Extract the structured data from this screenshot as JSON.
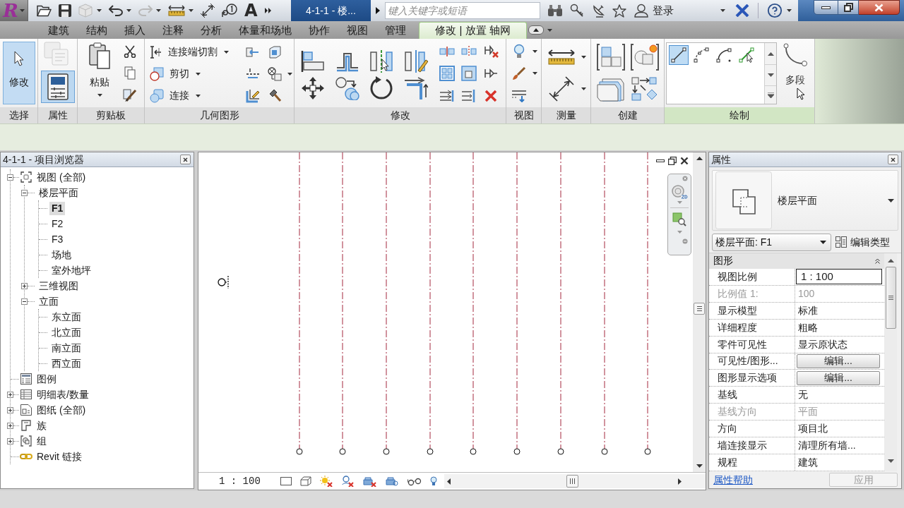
{
  "title_bar": {
    "app_logo": "R",
    "quick_access": [
      {
        "kind": "open",
        "disabled": false
      },
      {
        "kind": "save",
        "disabled": false
      },
      {
        "kind": "sync",
        "disabled": true
      },
      {
        "kind": "undo",
        "disabled": false
      },
      {
        "kind": "redo",
        "disabled": true
      },
      {
        "kind": "measure",
        "disabled": false
      },
      {
        "kind": "dimension",
        "disabled": false
      },
      {
        "kind": "tag",
        "disabled": false
      },
      {
        "kind": "text",
        "label": "A",
        "disabled": false
      }
    ],
    "document_title": "4-1-1 - 楼...",
    "search": {
      "placeholder": "键入关键字或短语"
    },
    "sign_in": "登录"
  },
  "ribbon": {
    "tabs": [
      {
        "label": "建筑",
        "selected": false
      },
      {
        "label": "结构",
        "selected": false
      },
      {
        "label": "插入",
        "selected": false
      },
      {
        "label": "注释",
        "selected": false
      },
      {
        "label": "分析",
        "selected": false
      },
      {
        "label": "体量和场地",
        "selected": false
      },
      {
        "label": "协作",
        "selected": false
      },
      {
        "label": "视图",
        "selected": false
      },
      {
        "label": "管理",
        "selected": false
      },
      {
        "label": "修改 | 放置 轴网",
        "selected": true
      }
    ],
    "panels": [
      {
        "kind": "select",
        "title": "选择",
        "tool": {
          "label": "修改",
          "selected": true
        }
      },
      {
        "kind": "properties",
        "title": "属性",
        "type_properties": {
          "disabled": true
        },
        "properties_toggle": {
          "selected": true
        }
      },
      {
        "kind": "clipboard",
        "title": "剪贴板",
        "paste": {
          "label": "粘贴"
        }
      },
      {
        "kind": "geometry",
        "title": "几何图形",
        "tools": [
          {
            "label": "连接端切割"
          },
          {
            "label": "剪切"
          },
          {
            "label": "连接"
          }
        ]
      },
      {
        "kind": "modify",
        "title": "修改"
      },
      {
        "kind": "view",
        "title": "视图"
      },
      {
        "kind": "measure",
        "title": "测量"
      },
      {
        "kind": "create",
        "title": "创建"
      },
      {
        "kind": "draw",
        "title": "绘制",
        "shapes": [
          {
            "selected": true
          },
          {
            "selected": false
          },
          {
            "selected": false
          },
          {
            "selected": false
          }
        ],
        "multi_segment": {
          "label": "多段"
        }
      }
    ]
  },
  "project_browser": {
    "title": "4-1-1 - 项目浏览器",
    "tree": [
      {
        "label": "视图 (全部)",
        "expanded": true,
        "selected": false,
        "children": [
          {
            "label": "楼层平面",
            "expanded": true,
            "selected": false,
            "children": [
              {
                "label": "F1",
                "selected": true
              },
              {
                "label": "F2",
                "selected": false
              },
              {
                "label": "F3",
                "selected": false
              },
              {
                "label": "场地",
                "selected": false
              },
              {
                "label": "室外地坪",
                "selected": false
              }
            ]
          },
          {
            "label": "三维视图",
            "expanded": false,
            "selected": false
          },
          {
            "label": "立面",
            "expanded": true,
            "selected": false,
            "children": [
              {
                "label": "东立面",
                "selected": false
              },
              {
                "label": "北立面",
                "selected": false
              },
              {
                "label": "南立面",
                "selected": false
              },
              {
                "label": "西立面",
                "selected": false
              }
            ]
          }
        ]
      },
      {
        "label": "图例",
        "selected": false
      },
      {
        "label": "明细表/数量",
        "expanded": false,
        "selected": false
      },
      {
        "label": "图纸 (全部)",
        "expanded": false,
        "selected": false
      },
      {
        "label": "族",
        "expanded": false,
        "selected": false
      },
      {
        "label": "组",
        "expanded": false,
        "selected": false
      },
      {
        "label": "Revit 链接",
        "selected": false
      }
    ]
  },
  "view": {
    "scale": "1 : 100"
  },
  "properties": {
    "title": "属性",
    "type_name": "楼层平面",
    "instance_selector": "楼层平面: F1",
    "edit_type": "编辑类型",
    "group": {
      "label": "图形",
      "expanded": true
    },
    "rows": [
      {
        "name": "视图比例",
        "value": "1 : 100",
        "kind": "input",
        "disabled": false
      },
      {
        "name": "比例值 1:",
        "value": "100",
        "kind": "text",
        "disabled": true
      },
      {
        "name": "显示模型",
        "value": "标准",
        "kind": "text",
        "disabled": false
      },
      {
        "name": "详细程度",
        "value": "粗略",
        "kind": "text",
        "disabled": false
      },
      {
        "name": "零件可见性",
        "value": "显示原状态",
        "kind": "text",
        "disabled": false
      },
      {
        "name": "可见性/图形...",
        "value": "编辑...",
        "kind": "button",
        "disabled": false
      },
      {
        "name": "图形显示选项",
        "value": "编辑...",
        "kind": "button",
        "disabled": false
      },
      {
        "name": "基线",
        "value": "无",
        "kind": "text",
        "disabled": false
      },
      {
        "name": "基线方向",
        "value": "平面",
        "kind": "text",
        "disabled": true
      },
      {
        "name": "方向",
        "value": "项目北",
        "kind": "text",
        "disabled": false
      },
      {
        "name": "墙连接显示",
        "value": "清理所有墙...",
        "kind": "text",
        "disabled": false
      },
      {
        "name": "规程",
        "value": "建筑",
        "kind": "text",
        "disabled": false
      }
    ],
    "help_link": "属性帮助",
    "apply_button": {
      "label": "应用",
      "disabled": true
    }
  }
}
